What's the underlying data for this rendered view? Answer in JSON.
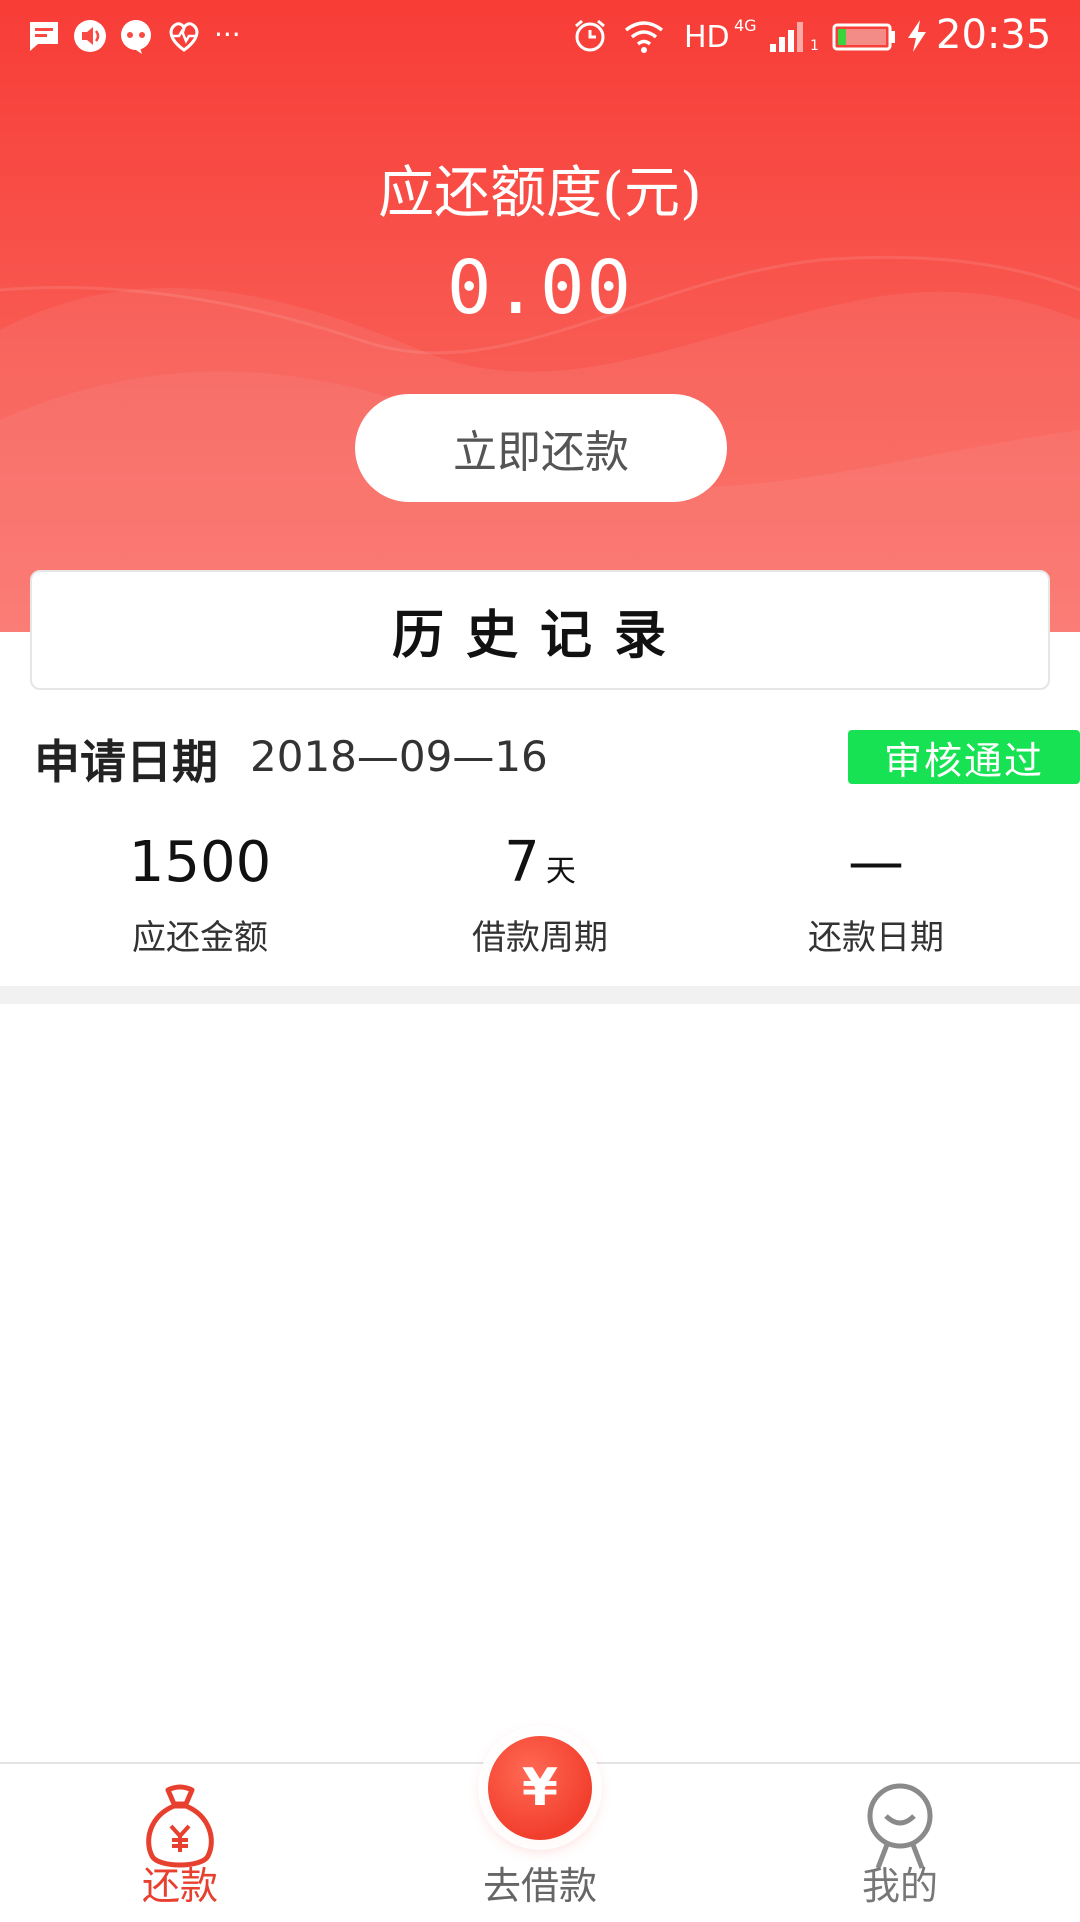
{
  "status_bar": {
    "time": "20:35",
    "network": "HD",
    "network_gen": "4G",
    "sim_slot": "1",
    "more": "···",
    "icons": [
      "message-icon",
      "speaker-icon",
      "chat-bubble-icon",
      "heart-rate-icon",
      "alarm-icon",
      "wifi-icon",
      "signal-icon",
      "battery-icon",
      "charging-icon"
    ]
  },
  "header": {
    "title": "应还额度(元)",
    "amount": "0.00",
    "repay_button": "立即还款"
  },
  "history": {
    "title": "历史记录"
  },
  "record": {
    "date_label": "申请日期",
    "date_value": "2018—09—16",
    "status": "审核通过",
    "amount_value": "1500",
    "amount_label": "应还金额",
    "period_value": "7",
    "period_unit": "天",
    "period_label": "借款周期",
    "repay_date_value": "—",
    "repay_date_label": "还款日期"
  },
  "tabbar": {
    "tabs": [
      {
        "label": "还款",
        "icon": "money-bag-icon",
        "active": true
      },
      {
        "label": "去借款",
        "icon": "yen-icon",
        "active": false
      },
      {
        "label": "我的",
        "icon": "profile-icon",
        "active": false
      }
    ],
    "center_symbol": "¥"
  },
  "colors": {
    "header_red": "#f83c36",
    "active_tab": "#e8402f",
    "inactive_tab": "#8a8a8a",
    "status_green": "#16e253"
  }
}
